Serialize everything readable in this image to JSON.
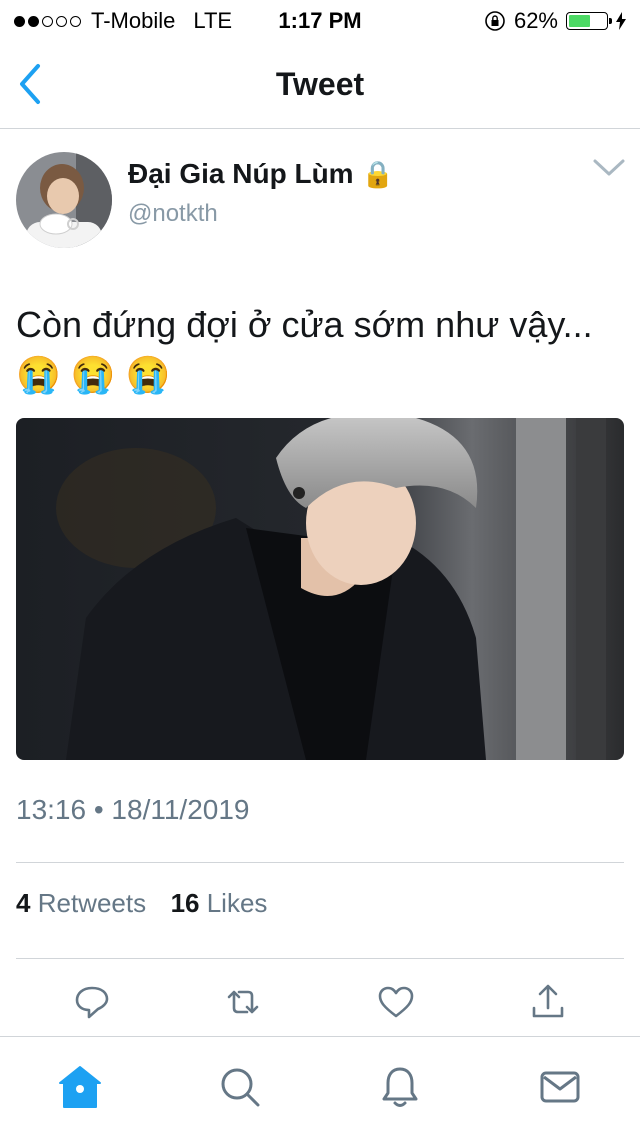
{
  "status_bar": {
    "carrier": "T-Mobile",
    "network": "LTE",
    "time": "1:17 PM",
    "battery": "62%",
    "battery_level": 0.62,
    "signal_bars_filled": 2
  },
  "nav": {
    "title": "Tweet",
    "back_icon": "chevron-left-icon"
  },
  "tweet": {
    "author_name": "Đại Gia Núp Lùm",
    "handle": "@notkth",
    "lock_icon": "🔒",
    "text": "Còn đứng đợi ở cửa sớm như vậy...😭 😭 😭",
    "timestamp": "13:16 • 18/11/2019",
    "retweets_count": "4",
    "retweets_label": "Retweets",
    "likes_count": "16",
    "likes_label": "Likes"
  },
  "colors": {
    "accent": "#1da1f2",
    "secondary_text": "#657786",
    "handle_text": "#8899a6",
    "divider": "#d1d5d9"
  },
  "actions": [
    "reply-icon",
    "retweet-icon",
    "like-icon",
    "share-icon"
  ],
  "tabs": [
    "home-icon",
    "search-icon",
    "notifications-icon",
    "messages-icon"
  ]
}
